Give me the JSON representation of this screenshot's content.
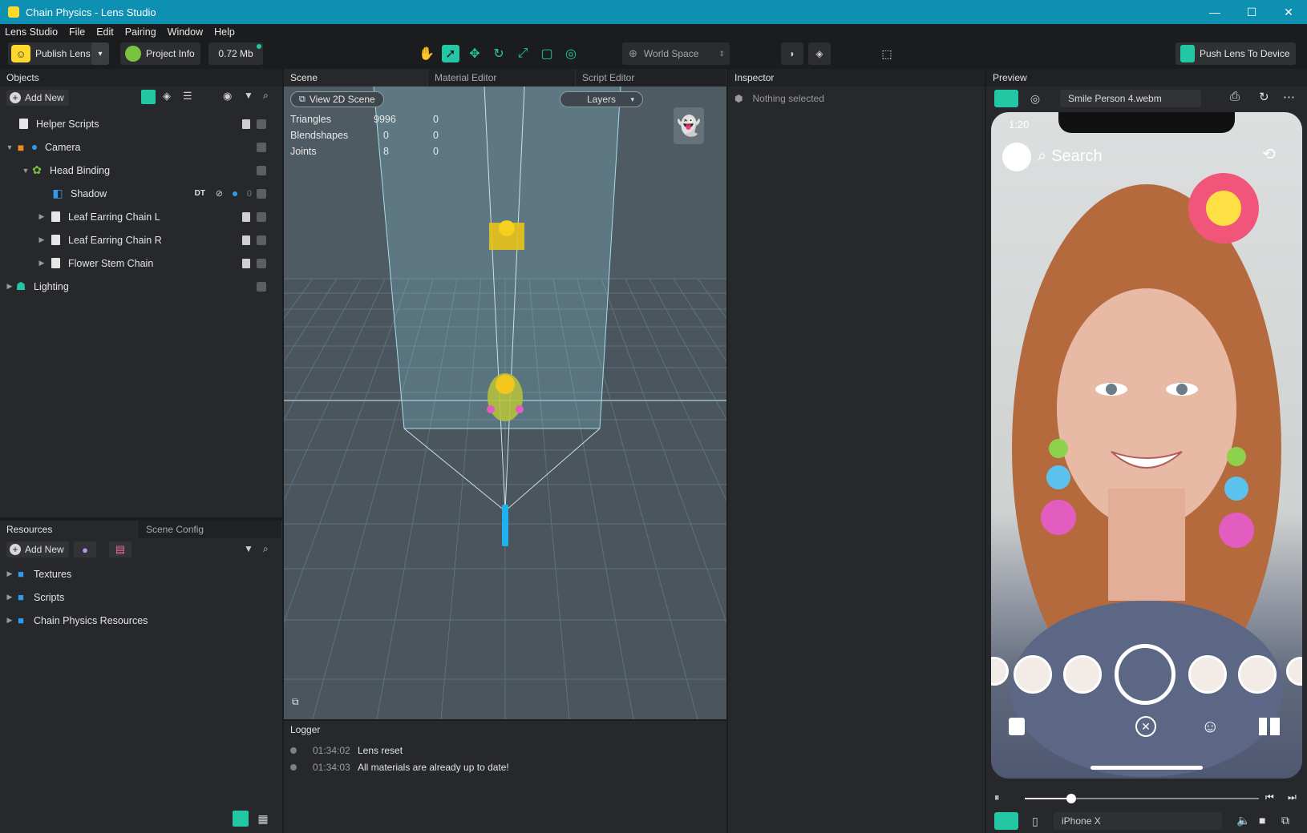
{
  "window": {
    "title": "Chain Physics - Lens Studio",
    "minimize": "—",
    "maximize": "☐",
    "close": "✕"
  },
  "menu": [
    "Lens Studio",
    "File",
    "Edit",
    "Pairing",
    "Window",
    "Help"
  ],
  "toolbar": {
    "publish_label": "Publish Lens",
    "project_info_label": "Project Info",
    "size_label": "0.72 Mb",
    "space_label": "World Space",
    "push_label": "Push Lens To Device"
  },
  "objects": {
    "header": "Objects",
    "add_new": "Add New",
    "items": [
      {
        "label": "Helper Scripts",
        "indent": 0,
        "arrow": ""
      },
      {
        "label": "Camera",
        "indent": 0,
        "arrow": "▼"
      },
      {
        "label": "Head Binding",
        "indent": 1,
        "arrow": "▼"
      },
      {
        "label": "Shadow",
        "indent": 2,
        "arrow": "",
        "tag": "DT",
        "count": "0"
      },
      {
        "label": "Leaf Earring Chain L",
        "indent": 2,
        "arrow": "▶"
      },
      {
        "label": "Leaf Earring Chain R",
        "indent": 2,
        "arrow": "▶"
      },
      {
        "label": "Flower Stem Chain",
        "indent": 2,
        "arrow": "▶"
      },
      {
        "label": "Lighting",
        "indent": 0,
        "arrow": "▶"
      }
    ]
  },
  "resources": {
    "tabs": [
      "Resources",
      "Scene Config"
    ],
    "add_new": "Add New",
    "items": [
      "Textures",
      "Scripts",
      "Chain Physics Resources"
    ]
  },
  "scene": {
    "tabs": [
      "Scene",
      "Material Editor",
      "Script Editor"
    ],
    "view2d_label": "View 2D Scene",
    "layers_label": "Layers",
    "stats": [
      {
        "name": "Triangles",
        "value": "9996",
        "extra": "0"
      },
      {
        "name": "Blendshapes",
        "value": "0",
        "extra": "0"
      },
      {
        "name": "Joints",
        "value": "8",
        "extra": "0"
      }
    ]
  },
  "logger": {
    "header": "Logger",
    "entries": [
      {
        "time": "01:34:02",
        "message": "Lens reset"
      },
      {
        "time": "01:34:03",
        "message": "All materials are already up to date!"
      }
    ]
  },
  "inspector": {
    "header": "Inspector",
    "empty_text": "Nothing selected"
  },
  "preview": {
    "header": "Preview",
    "media_label": "Smile Person 4.webm",
    "clock": "1:20",
    "search_label": "Search",
    "device_label": "iPhone X",
    "playback_progress": 0.2
  },
  "colors": {
    "accent": "#24c7a4",
    "titlebar": "#0e90b3",
    "panel": "#26282b"
  }
}
